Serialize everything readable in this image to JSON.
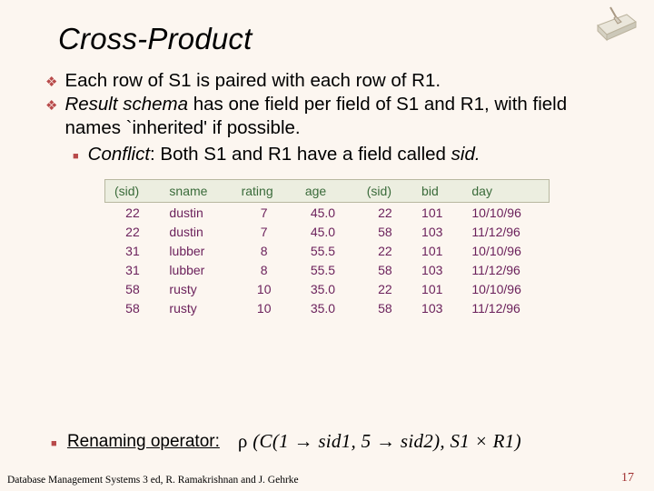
{
  "title": "Cross-Product",
  "bullets": {
    "b1": "Each row of S1 is paired with each row of R1.",
    "b2a": "Result schema",
    "b2b": " has one field per field of S1 and R1, with field names `inherited' if possible.",
    "sub_a": "Conflict",
    "sub_b": ":  Both S1 and R1 have a field called ",
    "sub_c": "sid."
  },
  "table": {
    "headers": [
      "(sid)",
      "sname",
      "rating",
      "age",
      "(sid)",
      "bid",
      "day"
    ],
    "rows": [
      [
        "22",
        "dustin",
        "7",
        "45.0",
        "22",
        "101",
        "10/10/96"
      ],
      [
        "22",
        "dustin",
        "7",
        "45.0",
        "58",
        "103",
        "11/12/96"
      ],
      [
        "31",
        "lubber",
        "8",
        "55.5",
        "22",
        "101",
        "10/10/96"
      ],
      [
        "31",
        "lubber",
        "8",
        "55.5",
        "58",
        "103",
        "11/12/96"
      ],
      [
        "58",
        "rusty",
        "10",
        "35.0",
        "22",
        "101",
        "10/10/96"
      ],
      [
        "58",
        "rusty",
        "10",
        "35.0",
        "58",
        "103",
        "11/12/96"
      ]
    ]
  },
  "renaming": {
    "label": " Renaming operator:",
    "formula": "ρ (C(1 → sid1, 5 → sid2), S1 × R1)"
  },
  "footer": "Database Management Systems 3 ed,  R. Ramakrishnan and J. Gehrke",
  "pagenum": "17"
}
